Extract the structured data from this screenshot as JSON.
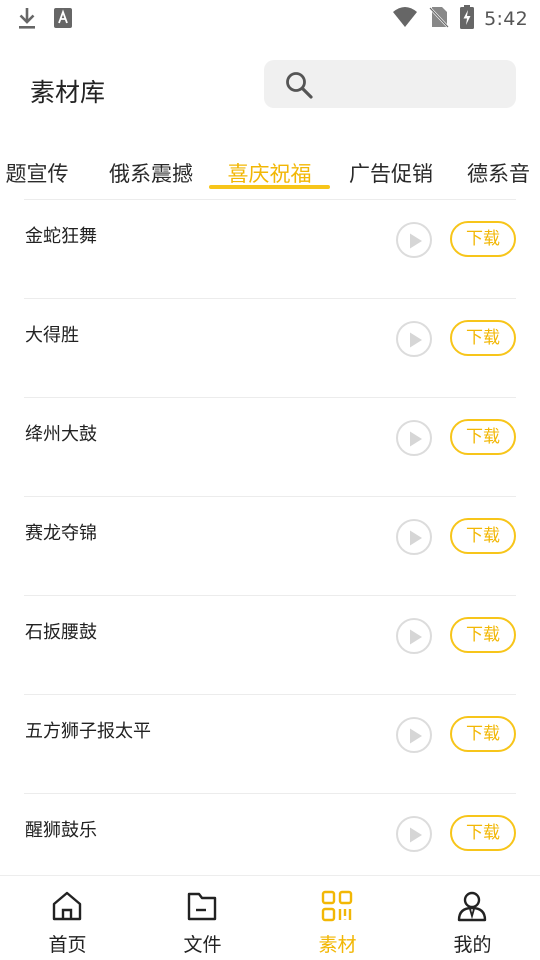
{
  "status_bar": {
    "time": "5:42",
    "left_icons": [
      "download-icon",
      "keyboard-a-icon"
    ],
    "right_icons": [
      "wifi-icon",
      "no-sim-icon",
      "battery-charging-icon"
    ]
  },
  "header": {
    "title": "素材库",
    "search": {
      "placeholder": "",
      "value": "",
      "icon": "search-icon"
    }
  },
  "tabs": [
    {
      "label": "题宣传",
      "active": false
    },
    {
      "label": "俄系震撼",
      "active": false
    },
    {
      "label": "喜庆祝福",
      "active": true
    },
    {
      "label": "广告促销",
      "active": false
    },
    {
      "label": "德系音",
      "active": false
    }
  ],
  "items": [
    {
      "title": "金蛇狂舞",
      "download_label": "下载"
    },
    {
      "title": "大得胜",
      "download_label": "下载"
    },
    {
      "title": "绛州大鼓",
      "download_label": "下载"
    },
    {
      "title": "赛龙夺锦",
      "download_label": "下载"
    },
    {
      "title": "石扳腰鼓",
      "download_label": "下载"
    },
    {
      "title": "五方狮子报太平",
      "download_label": "下载"
    },
    {
      "title": "醒狮鼓乐",
      "download_label": "下载"
    }
  ],
  "bottom_nav": [
    {
      "label": "首页",
      "icon": "home-icon",
      "active": false
    },
    {
      "label": "文件",
      "icon": "folder-icon",
      "active": false
    },
    {
      "label": "素材",
      "icon": "qr-grid-icon",
      "active": true
    },
    {
      "label": "我的",
      "icon": "user-icon",
      "active": false
    }
  ],
  "colors": {
    "accent": "#f7c51a",
    "accent_text": "#f2b705",
    "text": "#222222",
    "search_bg": "#f0f0f0",
    "divider": "#ececec"
  }
}
